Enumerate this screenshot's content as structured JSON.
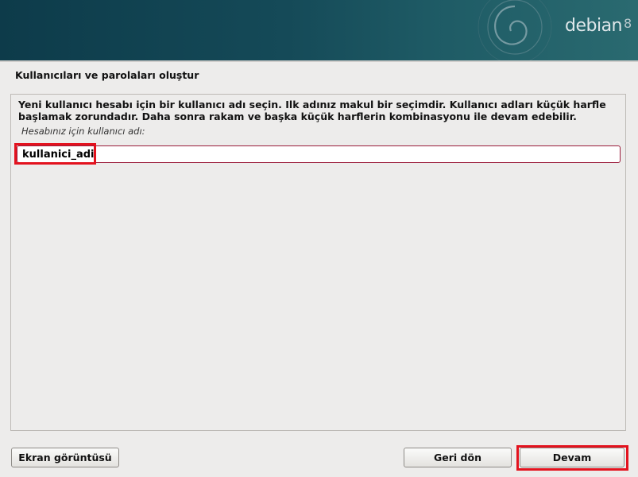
{
  "header": {
    "brand": "debian",
    "version": "8"
  },
  "page": {
    "title": "Kullanıcıları ve parolaları oluştur",
    "description": "Yeni kullanıcı hesabı için bir kullanıcı adı seçin. Ilk adınız makul bir seçimdir. Kullanıcı adları küçük harfle başlamak zorundadır. Daha sonra rakam ve başka küçük harflerin kombinasyonu ile devam edebilir.",
    "field_label": "Hesabınız için kullanıcı adı:",
    "field_value": "kullanici_adi"
  },
  "buttons": {
    "screenshot": "Ekran görüntüsü",
    "back": "Geri dön",
    "continue": "Devam"
  },
  "colors": {
    "banner": "#0d3b4a",
    "highlight": "#e3121e",
    "input_border": "#9a1b3a",
    "background": "#edeceb"
  }
}
